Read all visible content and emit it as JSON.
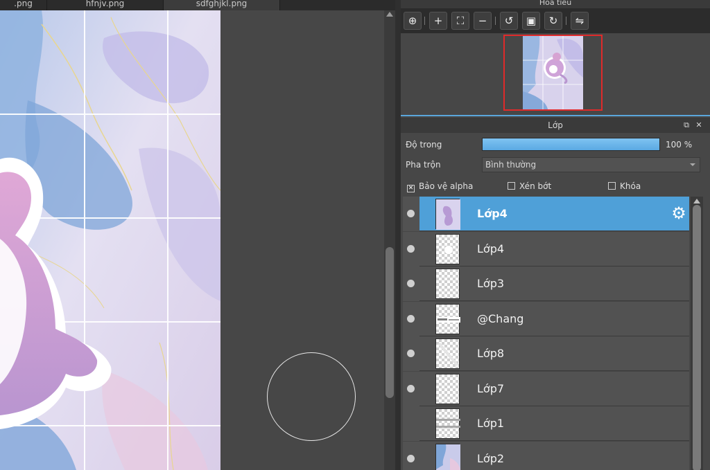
{
  "tabs": [
    {
      "label": ".png"
    },
    {
      "label": "hfnjv.png"
    },
    {
      "label": "sdfghjkl.png"
    }
  ],
  "navigator": {
    "title": "Hoa tiêu",
    "tools": [
      {
        "icon": "zoom-fit-icon",
        "glyph": "⊕"
      },
      {
        "icon": "zoom-in-icon",
        "glyph": "+"
      },
      {
        "icon": "fit-window-icon",
        "glyph": "⛶"
      },
      {
        "icon": "zoom-out-icon",
        "glyph": "−"
      },
      {
        "icon": "rotate-left-icon",
        "glyph": "↺"
      },
      {
        "icon": "actual-size-icon",
        "glyph": "▣"
      },
      {
        "icon": "rotate-right-icon",
        "glyph": "↻"
      },
      {
        "icon": "flip-horizontal-icon",
        "glyph": "⇋"
      }
    ]
  },
  "layers_panel": {
    "title": "Lớp",
    "opacity_label": "Độ trong",
    "opacity_percent": 100,
    "opacity_text": "100 %",
    "blend_label": "Pha trộn",
    "blend_value": "Bình thường",
    "protect_alpha": {
      "label": "Bảo vệ alpha",
      "checked": true,
      "mark": "✕"
    },
    "clipping": {
      "label": "Xén bớt",
      "checked": false
    },
    "lock": {
      "label": "Khóa",
      "checked": false
    },
    "gear_glyph": "⚙",
    "layers": [
      {
        "name": "Lớp4",
        "visible": true,
        "selected": true
      },
      {
        "name": "Lớp4",
        "visible": true,
        "selected": false
      },
      {
        "name": "Lớp3",
        "visible": true,
        "selected": false
      },
      {
        "name": "@Chang",
        "visible": true,
        "selected": false
      },
      {
        "name": "Lớp8",
        "visible": true,
        "selected": false
      },
      {
        "name": "Lớp7",
        "visible": true,
        "selected": false
      },
      {
        "name": "Lớp1",
        "visible": false,
        "selected": false
      },
      {
        "name": "Lớp2",
        "visible": true,
        "selected": false
      }
    ]
  },
  "colors": {
    "accent": "#4fa0d8",
    "marble_blue": "#8fb4dd",
    "marble_lilac": "#c4bde6",
    "character_pink": "#d6a3d2",
    "character_purple": "#b996cf",
    "navigator_frame": "#e02a2a"
  }
}
